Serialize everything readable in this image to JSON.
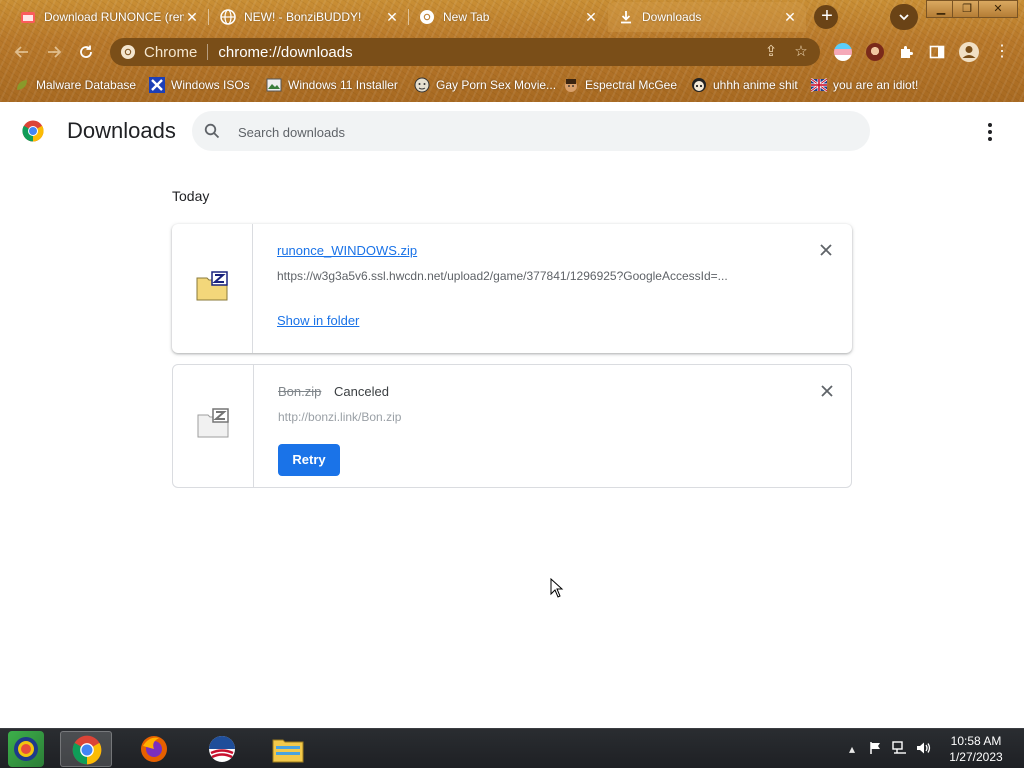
{
  "window": {
    "controls": [
      "minimize",
      "restore",
      "close"
    ]
  },
  "tabs": [
    {
      "label": "Download RUNONCE (rem",
      "favicon": "itch-io-icon",
      "active": false
    },
    {
      "label": "NEW! - BonziBUDDY!",
      "favicon": "globe-icon",
      "active": false
    },
    {
      "label": "New Tab",
      "favicon": "chrome-icon",
      "active": false
    },
    {
      "label": "Downloads",
      "favicon": "download-icon",
      "active": true
    }
  ],
  "toolbar": {
    "site_chip": "Chrome",
    "url": "chrome://downloads"
  },
  "bookmarks": [
    {
      "label": "Malware Database",
      "icon": "green-leaf-icon"
    },
    {
      "label": "Windows ISOs",
      "icon": "x-logo-icon"
    },
    {
      "label": "Windows 11 Installer",
      "icon": "image-icon"
    },
    {
      "label": "Gay Porn Sex Movie...",
      "icon": "face-icon"
    },
    {
      "label": "Espectral McGee",
      "icon": "face-icon"
    },
    {
      "label": "uhhh anime shit",
      "icon": "anime-face-icon"
    },
    {
      "label": "you are an idiot!",
      "icon": "uk-flag-icon"
    }
  ],
  "page": {
    "title": "Downloads",
    "search_placeholder": "Search downloads",
    "section_label": "Today"
  },
  "downloads": [
    {
      "filename": "runonce_WINDOWS.zip",
      "url": "https://w3g3a5v6.ssl.hwcdn.net/upload2/game/377841/1296925?GoogleAccessId=...",
      "action_label": "Show in folder",
      "status": ""
    },
    {
      "filename": "Bon.zip",
      "url": "http://bonzi.link/Bon.zip",
      "action_label": "Retry",
      "status": "Canceled"
    }
  ],
  "taskbar": {
    "apps": [
      "start-orb",
      "chrome",
      "firefox",
      "obama-logo",
      "file-explorer"
    ],
    "time": "10:58 AM",
    "date": "1/27/2023"
  },
  "colors": {
    "accent": "#1a73e8",
    "theme_brown": "#b8782a"
  }
}
